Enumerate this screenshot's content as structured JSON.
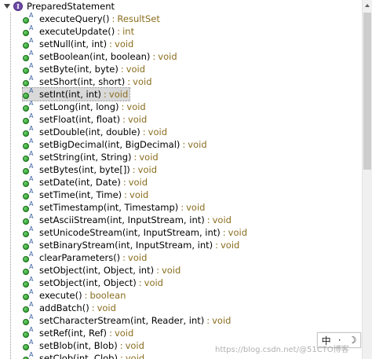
{
  "outline": {
    "root_label": "PreparedStatement",
    "root_icon": "interface-icon",
    "selected_index": 6,
    "methods": [
      {
        "name": "executeQuery()",
        "ret": "ResultSet"
      },
      {
        "name": "executeUpdate()",
        "ret": "int"
      },
      {
        "name": "setNull(int, int)",
        "ret": "void"
      },
      {
        "name": "setBoolean(int, boolean)",
        "ret": "void"
      },
      {
        "name": "setByte(int, byte)",
        "ret": "void"
      },
      {
        "name": "setShort(int, short)",
        "ret": "void"
      },
      {
        "name": "setInt(int, int)",
        "ret": "void"
      },
      {
        "name": "setLong(int, long)",
        "ret": "void"
      },
      {
        "name": "setFloat(int, float)",
        "ret": "void"
      },
      {
        "name": "setDouble(int, double)",
        "ret": "void"
      },
      {
        "name": "setBigDecimal(int, BigDecimal)",
        "ret": "void"
      },
      {
        "name": "setString(int, String)",
        "ret": "void"
      },
      {
        "name": "setBytes(int, byte[])",
        "ret": "void"
      },
      {
        "name": "setDate(int, Date)",
        "ret": "void"
      },
      {
        "name": "setTime(int, Time)",
        "ret": "void"
      },
      {
        "name": "setTimestamp(int, Timestamp)",
        "ret": "void"
      },
      {
        "name": "setAsciiStream(int, InputStream, int)",
        "ret": "void"
      },
      {
        "name": "setUnicodeStream(int, InputStream, int)",
        "ret": "void"
      },
      {
        "name": "setBinaryStream(int, InputStream, int)",
        "ret": "void"
      },
      {
        "name": "clearParameters()",
        "ret": "void"
      },
      {
        "name": "setObject(int, Object, int)",
        "ret": "void"
      },
      {
        "name": "setObject(int, Object)",
        "ret": "void"
      },
      {
        "name": "execute()",
        "ret": "boolean"
      },
      {
        "name": "addBatch()",
        "ret": "void"
      },
      {
        "name": "setCharacterStream(int, Reader, int)",
        "ret": "void"
      },
      {
        "name": "setRef(int, Ref)",
        "ret": "void"
      },
      {
        "name": "setBlob(int, Blob)",
        "ret": "void"
      },
      {
        "name": "setClob(int, Clob)",
        "ret": "void"
      }
    ],
    "separator": ":",
    "abstract_marker": "A"
  },
  "ime": {
    "lang": "中",
    "punct": "·",
    "mode": "☽"
  },
  "watermark": {
    "text": "https://blog.csdn.net/@51CTO博客"
  },
  "colors": {
    "method_icon": "#1f8f1f",
    "return_type": "#8a6d1f",
    "interface_icon": "#6e4aa6",
    "selection": "#d9d9d9"
  }
}
